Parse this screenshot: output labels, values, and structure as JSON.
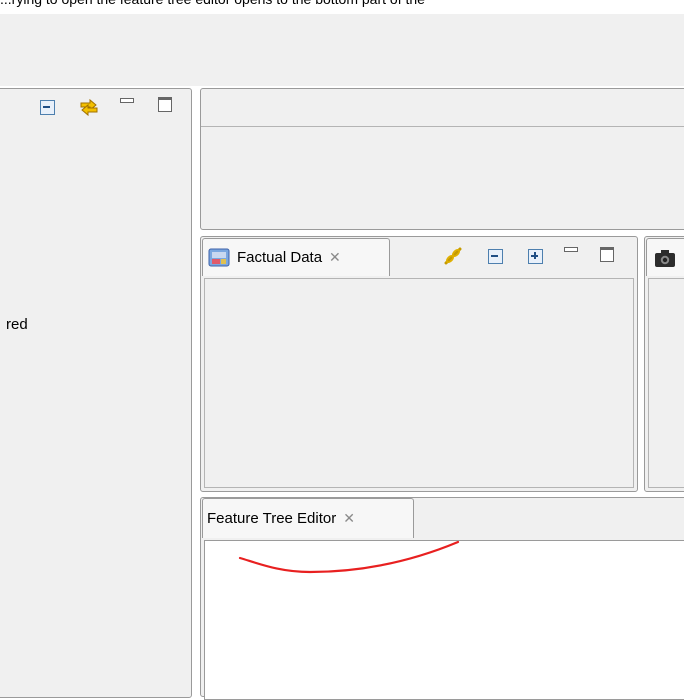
{
  "caption": "...rying to open the feature tree editor opens to the bottom part of the",
  "left_panel": {
    "partial_text": "red",
    "toolbar_icons": [
      "collapse-all-icon",
      "link-with-editor-icon",
      "minimize-icon",
      "maximize-icon"
    ]
  },
  "factual_data_view": {
    "tab_label": "Factual Data",
    "close_symbol": "✕",
    "toolbar_icons": [
      "link-icon",
      "collapse-all-icon",
      "expand-all-icon",
      "minimize-icon",
      "maximize-icon"
    ]
  },
  "right_view": {
    "tab_icon": "camera-icon"
  },
  "feature_tree_editor": {
    "tab_label": "Feature Tree Editor",
    "close_symbol": "✕"
  },
  "colors": {
    "panel_bg": "#f0f0f0",
    "border": "#9a9a9a",
    "annotation_red": "#e82020"
  }
}
